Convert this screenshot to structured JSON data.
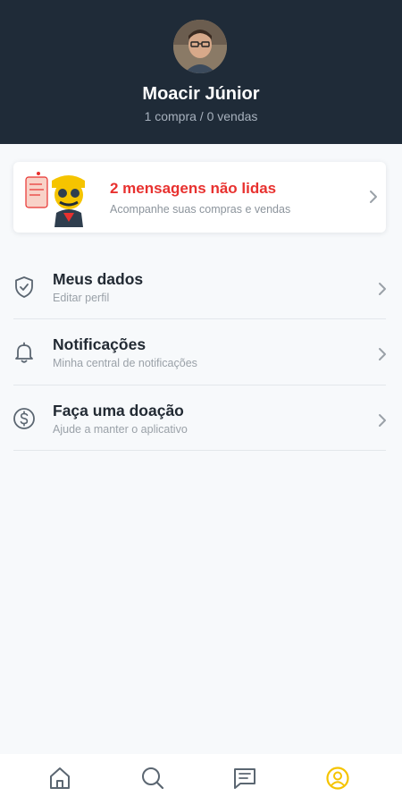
{
  "profile": {
    "name": "Moacir Júnior",
    "stats": "1 compra / 0 vendas"
  },
  "messages_card": {
    "title": "2 mensagens não lidas",
    "subtitle": "Acompanhe suas compras e vendas"
  },
  "menu": [
    {
      "title": "Meus dados",
      "subtitle": "Editar perfil",
      "icon": "shield-check-icon"
    },
    {
      "title": "Notificações",
      "subtitle": "Minha central de notificações",
      "icon": "bell-icon"
    },
    {
      "title": "Faça uma doação",
      "subtitle": "Ajude a manter o aplicativo",
      "icon": "dollar-circle-icon"
    }
  ],
  "bottom_nav": [
    {
      "icon": "home-icon",
      "active": false
    },
    {
      "icon": "search-icon",
      "active": false
    },
    {
      "icon": "chat-icon",
      "active": false
    },
    {
      "icon": "user-circle-icon",
      "active": true
    }
  ],
  "colors": {
    "header_bg": "#1f2b38",
    "accent_red": "#e8312f",
    "active_nav": "#f5c400",
    "inactive_nav": "#5b6671"
  }
}
